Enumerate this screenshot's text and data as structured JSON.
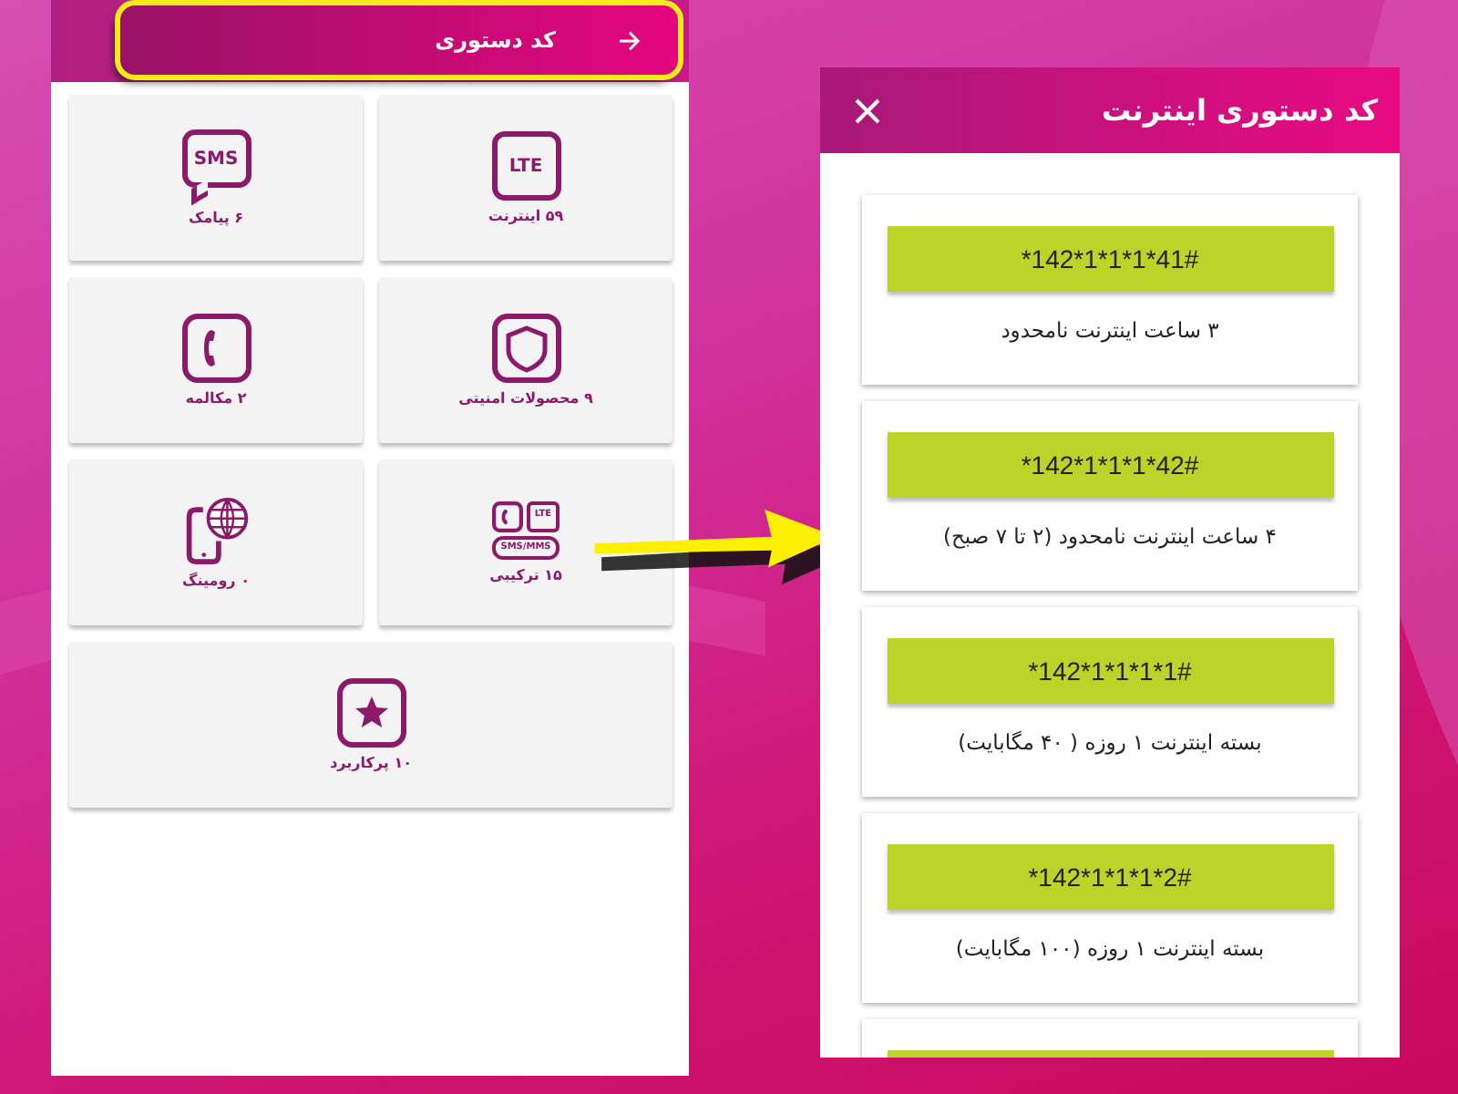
{
  "left_screen": {
    "header": {
      "title": "کد دستوری",
      "highlighted": true
    },
    "tiles": [
      {
        "kind": "lte",
        "icon_text": "LTE",
        "label": "۵۹ اینترنت",
        "wide": false
      },
      {
        "kind": "sms",
        "icon_text": "SMS",
        "label": "۶ پیامک",
        "wide": false
      },
      {
        "kind": "shield",
        "label": "۹ محصولات امنیتی",
        "wide": false
      },
      {
        "kind": "phone",
        "label": "۲ مکالمه",
        "wide": false
      },
      {
        "kind": "combo",
        "icon_text": "LTE",
        "icon_text_2": "SMS/MMS",
        "label": "۱۵ ترکیبی",
        "wide": false
      },
      {
        "kind": "globe",
        "label": "۰ رومینگ",
        "wide": false
      },
      {
        "kind": "star",
        "label": "۱۰ پرکاربرد",
        "wide": true
      }
    ]
  },
  "right_screen": {
    "title": "کد دستوری اینترنت",
    "codes": [
      {
        "code": "*142*1*1*1*41#",
        "description": "۳ ساعت اینترنت نامحدود"
      },
      {
        "code": "*142*1*1*1*42#",
        "description": "۴ ساعت اینترنت نامحدود (۲ تا ۷ صبح)"
      },
      {
        "code": "*142*1*1*1*1#",
        "description": "بسته اینترنت ۱ روزه ( ۴۰ مگابایت)"
      },
      {
        "code": "*142*1*1*1*2#",
        "description": "بسته اینترنت ۱ روزه (۱۰۰ مگابایت)"
      }
    ],
    "more_below": true
  }
}
